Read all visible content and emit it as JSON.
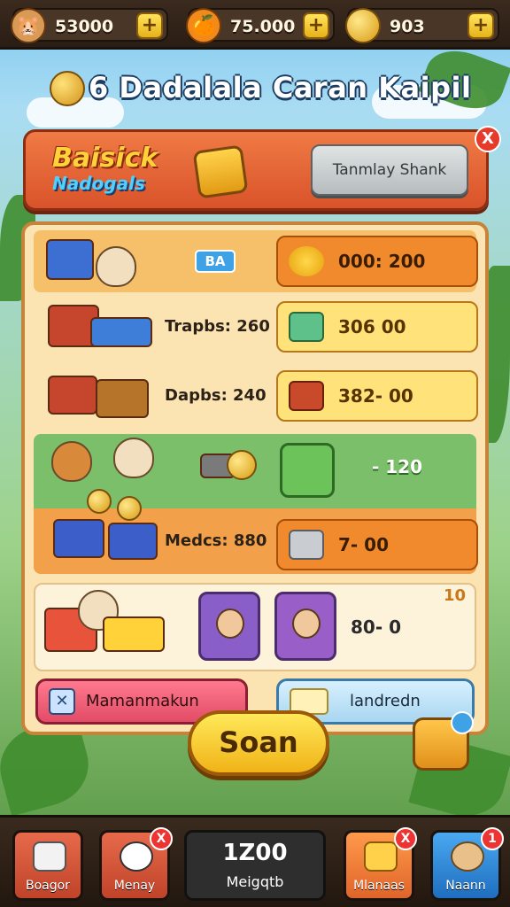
{
  "resources": [
    {
      "name": "hamster",
      "value": "53000",
      "icon": "hamster-icon"
    },
    {
      "name": "orange",
      "value": "75.000",
      "icon": "orange-icon"
    },
    {
      "name": "coin",
      "value": "903",
      "icon": "coin-icon"
    }
  ],
  "header": {
    "title_number": "6",
    "title": "Dadalala Caran Kaipil"
  },
  "banner": {
    "logo_top": "Baisick",
    "logo_bottom": "Nadogals",
    "button_label": "Tanmlay Shank",
    "close_label": "X"
  },
  "offers": [
    {
      "tag": "BA",
      "label": "",
      "price": "000: 200"
    },
    {
      "label": "Trapbs: 260",
      "price": "306  00"
    },
    {
      "label": "Dapbs: 240",
      "price": "382-  00"
    },
    {
      "label": "",
      "price": "- 120"
    },
    {
      "label": "Medcs: 880",
      "price": "7-  00"
    },
    {
      "label": "",
      "price": "80-  0",
      "corner": "10"
    }
  ],
  "buttons": {
    "left": "Mamanmakun",
    "right": "landredn",
    "main": "Soan"
  },
  "nav": [
    {
      "label": "Boagor",
      "icon": "bag-icon"
    },
    {
      "label": "Menay",
      "icon": "panda-icon",
      "badge": "X"
    },
    {
      "label": "Meigqtb",
      "value": "1Z00"
    },
    {
      "label": "Mlanaas",
      "icon": "cheese-icon",
      "badge": "X"
    },
    {
      "label": "Naann",
      "icon": "leaf-icon",
      "badge": "1"
    }
  ],
  "colors": {
    "topbar": "#2a1d14",
    "banner": "#e0622f",
    "panel": "#fbe3b2",
    "accent_gold": "#f0b317"
  }
}
